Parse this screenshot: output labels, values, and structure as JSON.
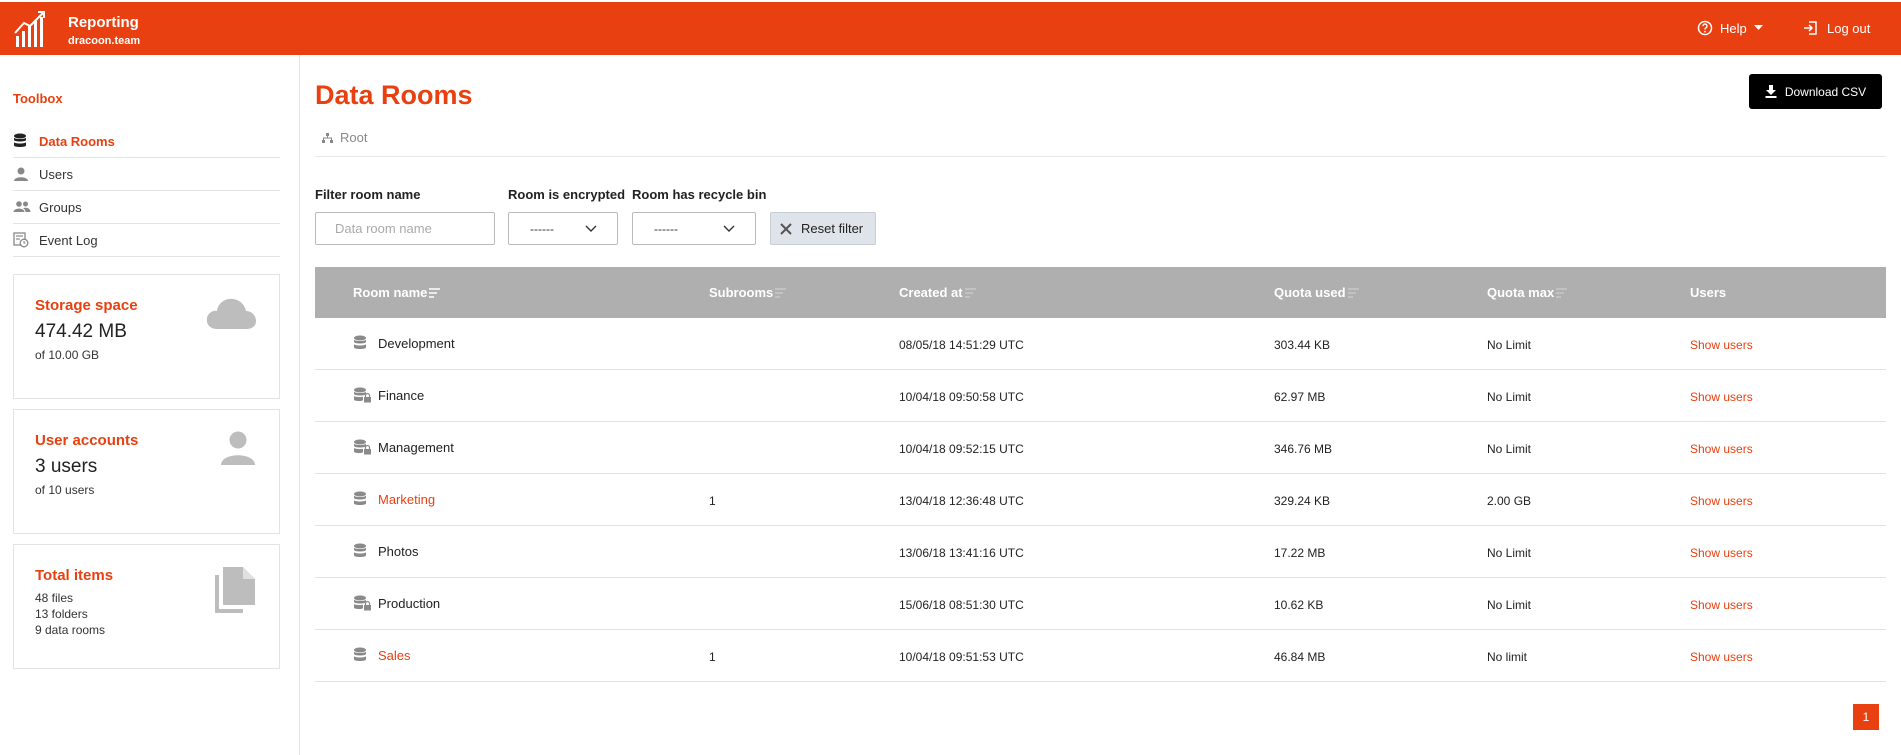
{
  "header": {
    "brand_title": "Reporting",
    "brand_sub": "dracoon.team",
    "help_label": "Help",
    "logout_label": "Log out"
  },
  "sidebar": {
    "toolbox_label": "Toolbox",
    "items": [
      {
        "label": "Data Rooms",
        "icon": "database-icon",
        "active": true
      },
      {
        "label": "Users",
        "icon": "user-icon",
        "active": false
      },
      {
        "label": "Groups",
        "icon": "group-icon",
        "active": false
      },
      {
        "label": "Event Log",
        "icon": "event-log-icon",
        "active": false
      }
    ],
    "storage": {
      "title": "Storage space",
      "value": "474.42 MB",
      "sub": "of 10.00 GB"
    },
    "accounts": {
      "title": "User accounts",
      "value": "3 users",
      "sub": "of 10 users"
    },
    "items_card": {
      "title": "Total items",
      "lines": [
        "48 files",
        "13 folders",
        "9 data rooms"
      ]
    }
  },
  "main": {
    "title": "Data Rooms",
    "download_label": "Download CSV",
    "breadcrumb": "Root"
  },
  "filters": {
    "name_label": "Filter room name",
    "name_placeholder": "Data room name",
    "encrypted_label": "Room is encrypted",
    "encrypted_value": "------",
    "recycle_label": "Room has recycle bin",
    "recycle_value": "------",
    "reset_label": "Reset filter"
  },
  "table": {
    "headers": [
      "Room name",
      "Subrooms",
      "Created at",
      "Quota used",
      "Quota max",
      "Users"
    ],
    "rows": [
      {
        "name": "Development",
        "encrypted": false,
        "link": false,
        "subrooms": "",
        "created": "08/05/18 14:51:29 UTC",
        "quota_used": "303.44 KB",
        "quota_max": "No Limit",
        "users": "Show users"
      },
      {
        "name": "Finance",
        "encrypted": true,
        "link": false,
        "subrooms": "",
        "created": "10/04/18 09:50:58 UTC",
        "quota_used": "62.97 MB",
        "quota_max": "No Limit",
        "users": "Show users"
      },
      {
        "name": "Management",
        "encrypted": true,
        "link": false,
        "subrooms": "",
        "created": "10/04/18 09:52:15 UTC",
        "quota_used": "346.76 MB",
        "quota_max": "No Limit",
        "users": "Show users"
      },
      {
        "name": "Marketing",
        "encrypted": false,
        "link": true,
        "subrooms": "1",
        "created": "13/04/18 12:36:48 UTC",
        "quota_used": "329.24 KB",
        "quota_max": "2.00 GB",
        "users": "Show users"
      },
      {
        "name": "Photos",
        "encrypted": false,
        "link": false,
        "subrooms": "",
        "created": "13/06/18 13:41:16 UTC",
        "quota_used": "17.22 MB",
        "quota_max": "No Limit",
        "users": "Show users"
      },
      {
        "name": "Production",
        "encrypted": true,
        "link": false,
        "subrooms": "",
        "created": "15/06/18 08:51:30 UTC",
        "quota_used": "10.62 KB",
        "quota_max": "No Limit",
        "users": "Show users"
      },
      {
        "name": "Sales",
        "encrypted": false,
        "link": true,
        "subrooms": "1",
        "created": "10/04/18 09:51:53 UTC",
        "quota_used": "46.84 MB",
        "quota_max": "No limit",
        "users": "Show users"
      }
    ]
  },
  "pagination": {
    "current_page": "1"
  },
  "colors": {
    "accent": "#e84010",
    "header_bg": "#e84010",
    "table_header_bg": "#afafaf",
    "button_dark": "#000000"
  }
}
